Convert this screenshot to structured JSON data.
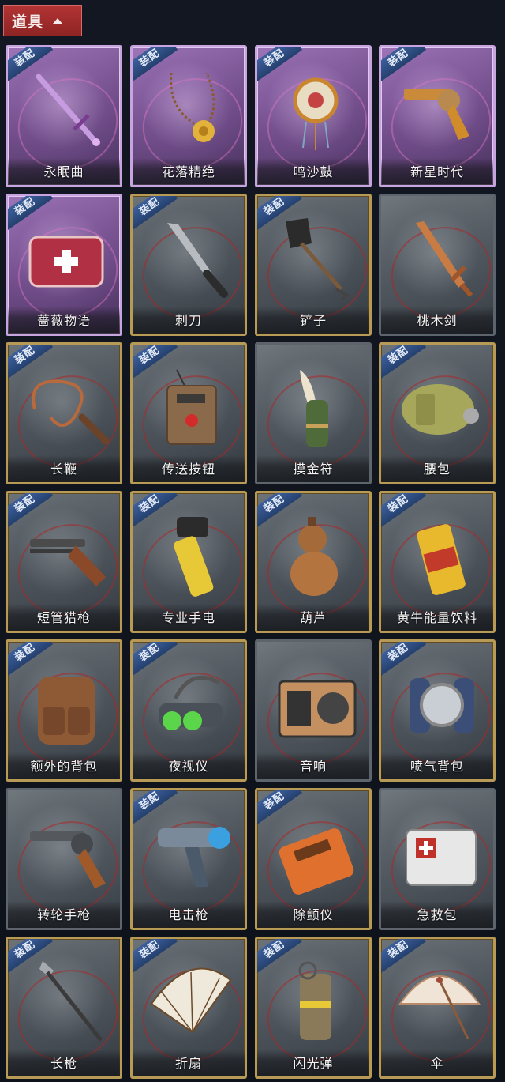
{
  "header": {
    "tab_label": "道具",
    "tab_icon": "chevron-up-icon",
    "tab_color": "#a82e2e"
  },
  "badge_text": "装配",
  "colors": {
    "normal_frame": "#b69a55",
    "rare_frame": "#c7a4df",
    "plain_frame": "#5d646b",
    "badge": "#2f4f86"
  },
  "items": [
    {
      "name": "永眠曲",
      "icon": "purple-sword-icon",
      "rarity": "rare",
      "equippable": true
    },
    {
      "name": "花落精绝",
      "icon": "flower-necklace-icon",
      "rarity": "rare",
      "equippable": true
    },
    {
      "name": "鸣沙鼓",
      "icon": "ornate-drum-icon",
      "rarity": "rare",
      "equippable": true
    },
    {
      "name": "新星时代",
      "icon": "golden-revolver-icon",
      "rarity": "rare",
      "equippable": true
    },
    {
      "name": "蔷薇物语",
      "icon": "rose-medkit-icon",
      "rarity": "rare",
      "equippable": true
    },
    {
      "name": "刺刀",
      "icon": "bayonet-icon",
      "rarity": "normal",
      "equippable": true
    },
    {
      "name": "铲子",
      "icon": "shovel-icon",
      "rarity": "normal",
      "equippable": true
    },
    {
      "name": "桃木剑",
      "icon": "wooden-sword-icon",
      "rarity": "plain",
      "equippable": false
    },
    {
      "name": "长鞭",
      "icon": "whip-icon",
      "rarity": "normal",
      "equippable": true
    },
    {
      "name": "传送按钮",
      "icon": "teleport-remote-icon",
      "rarity": "normal",
      "equippable": true
    },
    {
      "name": "摸金符",
      "icon": "tooth-amulet-icon",
      "rarity": "plain",
      "equippable": false
    },
    {
      "name": "腰包",
      "icon": "waist-bag-icon",
      "rarity": "normal",
      "equippable": true
    },
    {
      "name": "短管猎枪",
      "icon": "sawed-off-shotgun-icon",
      "rarity": "normal",
      "equippable": true
    },
    {
      "name": "专业手电",
      "icon": "flashlight-icon",
      "rarity": "normal",
      "equippable": true
    },
    {
      "name": "葫芦",
      "icon": "gourd-icon",
      "rarity": "normal",
      "equippable": true
    },
    {
      "name": "黄牛能量饮料",
      "icon": "energy-drink-can-icon",
      "rarity": "normal",
      "equippable": true
    },
    {
      "name": "额外的背包",
      "icon": "backpack-icon",
      "rarity": "normal",
      "equippable": true
    },
    {
      "name": "夜视仪",
      "icon": "night-vision-goggles-icon",
      "rarity": "normal",
      "equippable": true
    },
    {
      "name": "音响",
      "icon": "radio-speaker-icon",
      "rarity": "plain",
      "equippable": false
    },
    {
      "name": "喷气背包",
      "icon": "jetpack-icon",
      "rarity": "normal",
      "equippable": true
    },
    {
      "name": "转轮手枪",
      "icon": "revolver-icon",
      "rarity": "plain",
      "equippable": false
    },
    {
      "name": "电击枪",
      "icon": "shock-gun-icon",
      "rarity": "normal",
      "equippable": true
    },
    {
      "name": "除颤仪",
      "icon": "defibrillator-icon",
      "rarity": "normal",
      "equippable": true
    },
    {
      "name": "急救包",
      "icon": "first-aid-kit-icon",
      "rarity": "plain",
      "equippable": false
    },
    {
      "name": "长枪",
      "icon": "spear-icon",
      "rarity": "normal",
      "equippable": true
    },
    {
      "name": "折扇",
      "icon": "folding-fan-icon",
      "rarity": "normal",
      "equippable": true
    },
    {
      "name": "闪光弹",
      "icon": "flashbang-icon",
      "rarity": "normal",
      "equippable": true
    },
    {
      "name": "伞",
      "icon": "umbrella-icon",
      "rarity": "normal",
      "equippable": true
    }
  ]
}
